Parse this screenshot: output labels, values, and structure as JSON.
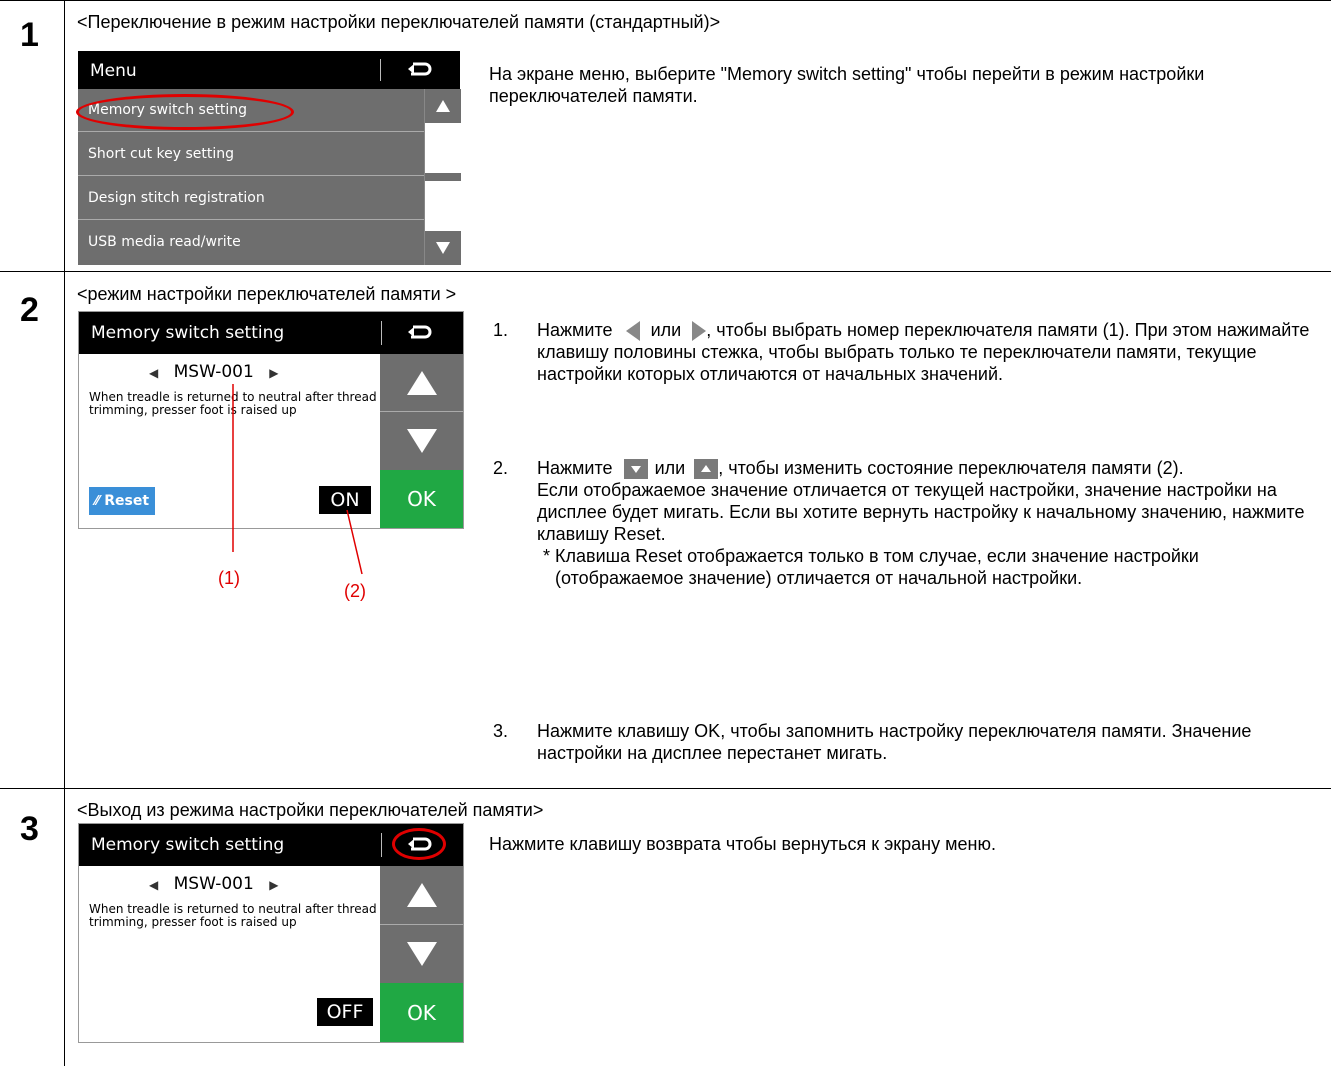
{
  "steps": [
    {
      "number": "1",
      "header": "<Переключение в режим настройки переключателей памяти (стандартный)>",
      "screen": {
        "title": "Menu",
        "items": [
          "Memory switch setting",
          "Short cut key setting",
          "Design stitch registration",
          "USB media read/write"
        ]
      },
      "text": "На экране меню, выберите \"Memory switch setting\" чтобы перейти в режим настройки переключателей памяти."
    },
    {
      "number": "2",
      "header": "<режим настройки переключателей памяти >",
      "screen": {
        "title": "Memory switch setting",
        "msw": "MSW-001",
        "description": "When treadle is returned to neutral after thread trimming, presser foot is raised up",
        "reset_label": "Reset",
        "value": "ON",
        "ok_label": "OK",
        "callout1": "(1)",
        "callout2": "(2)"
      },
      "instructions": [
        {
          "num": "1.",
          "pre": "Нажмите",
          "mid": "или",
          "post": ", чтобы выбрать номер переключателя памяти (1). При этом нажимайте клавишу половины стежка, чтобы выбрать только те переключатели памяти, текущие настройки которых отличаются от начальных значений."
        },
        {
          "num": "2.",
          "pre": "Нажмите",
          "mid": "или",
          "post": ", чтобы изменить состояние переключателя памяти (2).",
          "extra": "Если отображаемое значение отличается от текущей настройки, значение настройки на дисплее будет мигать. Если вы хотите вернуть настройку к начальному значению, нажмите клавишу Reset.",
          "note": "* Клавиша Reset отображается только в том случае, если значение настройки (отображаемое значение) отличается от начальной настройки."
        },
        {
          "num": "3.",
          "text": "Нажмите клавишу OK, чтобы запомнить настройку переключателя памяти. Значение настройки на дисплее перестанет мигать."
        }
      ]
    },
    {
      "number": "3",
      "header": "<Выход из режима настройки переключателей памяти>",
      "screen": {
        "title": "Memory switch setting",
        "msw": "MSW-001",
        "description": "When treadle is returned to neutral after thread trimming, presser foot is raised up",
        "value": "OFF",
        "ok_label": "OK"
      },
      "text": "Нажмите клавишу возврата чтобы вернуться к экрану меню."
    }
  ],
  "icons": [
    "return-arrow-icon",
    "arrow-up-icon",
    "arrow-down-icon",
    "arrow-left-icon",
    "arrow-right-icon",
    "pencil-icon"
  ],
  "colors": {
    "ok_green": "#20a844",
    "button_gray": "#6e6e6e",
    "reset_blue": "#3a8fd8",
    "highlight_red": "#e00000"
  }
}
